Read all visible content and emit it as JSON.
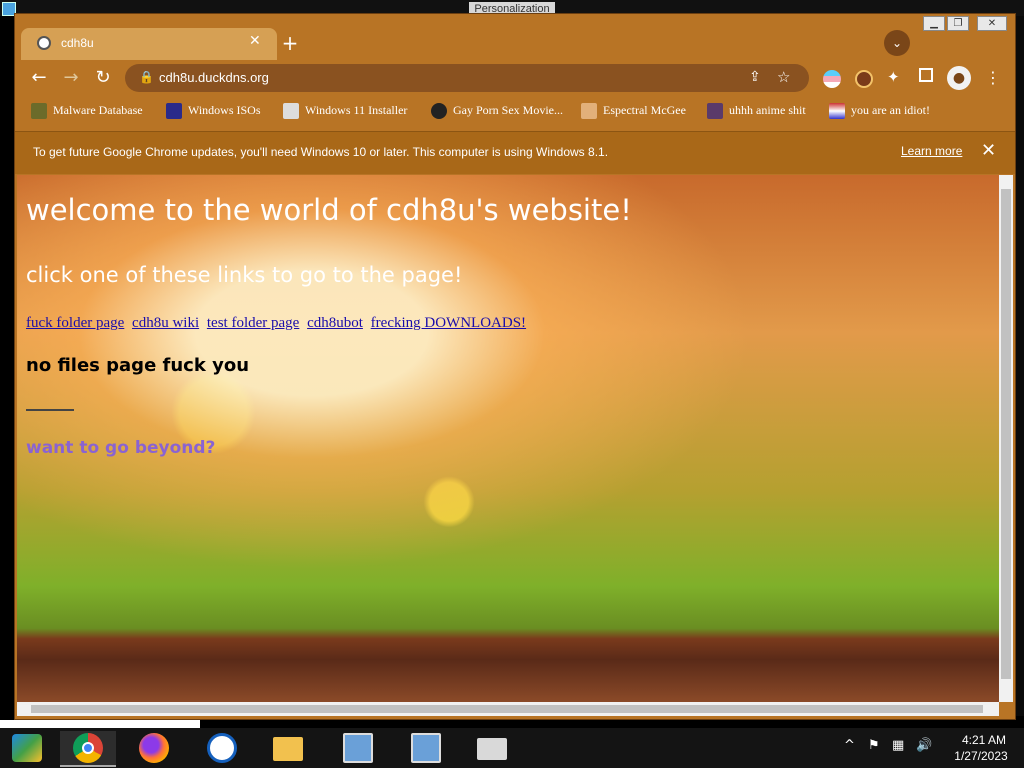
{
  "desktop": {
    "background_window_title": "Personalization"
  },
  "browser": {
    "tab": {
      "title": "cdh8u"
    },
    "omnibox": {
      "url": "cdh8u.duckdns.org"
    },
    "bookmarks": [
      "Malware Database",
      "Windows ISOs",
      "Windows 11 Installer",
      "Gay Porn Sex Movie...",
      "Espectral McGee",
      "uhhh anime shit",
      "you are an idiot!"
    ],
    "infobar": {
      "message": "To get future Google Chrome updates, you'll need Windows 10 or later. This computer is using Windows 8.1.",
      "link": "Learn more"
    }
  },
  "page": {
    "title": "welcome to the world of cdh8u's website!",
    "subtitle": "click one of these links to go to the page!",
    "links": [
      "fuck folder page",
      "cdh8u wiki",
      "test folder page",
      "cdh8ubot",
      "frecking DOWNLOADS!"
    ],
    "no_files_heading": "no files page fuck you",
    "go_beyond": "want to go beyond?"
  },
  "taskbar": {
    "clock_time": "4:21 AM",
    "clock_date": "1/27/2023"
  },
  "colors": {
    "link": "#1a0dab",
    "go_beyond": "#8a63d2",
    "chrome_theme": "#b87425"
  }
}
